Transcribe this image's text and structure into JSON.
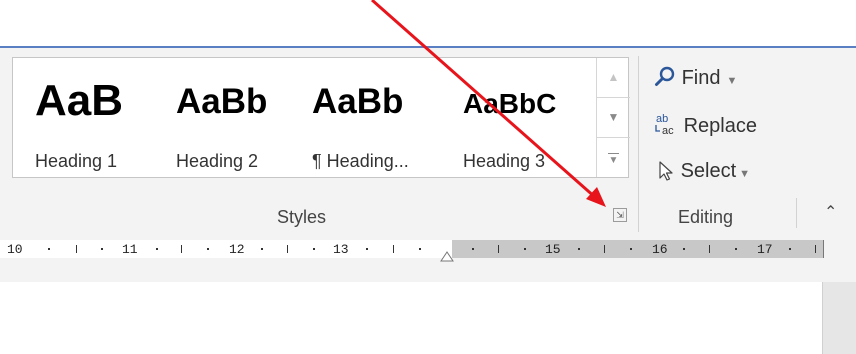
{
  "styles_gallery": {
    "items": [
      {
        "sample": "AaB",
        "label": "Heading 1"
      },
      {
        "sample": "AaBb",
        "label": "Heading 2"
      },
      {
        "sample": "AaBb",
        "label": "¶ Heading..."
      },
      {
        "sample": "AaBbC",
        "label": "Heading 3"
      }
    ],
    "scroll_up_glyph": "▲",
    "scroll_down_glyph": "▼",
    "more_glyph": "▼"
  },
  "groups": {
    "styles_label": "Styles",
    "editing_label": "Editing"
  },
  "editing": {
    "find": {
      "label": "Find",
      "caret": "▼",
      "icon": "magnifier-icon"
    },
    "replace": {
      "label": "Replace",
      "icon": "replace-ab-ac-icon"
    },
    "select": {
      "label": "Select",
      "caret": "▼",
      "icon": "cursor-arrow-icon"
    }
  },
  "ribbon": {
    "collapse_glyph": "⌃",
    "launcher_glyph": "⇲"
  },
  "ruler": {
    "numbers": [
      "10",
      "11",
      "12",
      "13",
      "15",
      "16",
      "17"
    ]
  },
  "colors": {
    "accent_line": "#5a7fc2",
    "annotation_arrow": "#e8141c",
    "find_icon": "#2b579a"
  }
}
